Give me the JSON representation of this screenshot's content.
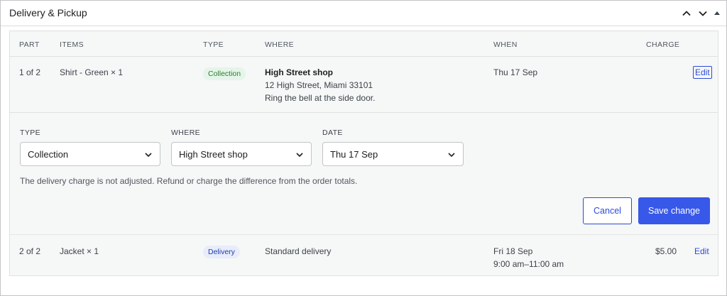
{
  "panel": {
    "title": "Delivery & Pickup",
    "controls": [
      "chevron-up-icon",
      "chevron-down-icon",
      "caret-up-icon"
    ]
  },
  "table": {
    "headers": [
      "Part",
      "Items",
      "Type",
      "Where",
      "When",
      "Charge"
    ],
    "rows": [
      {
        "part": "1 of 2",
        "items": "Shirt - Green × 1",
        "type": "Collection",
        "where_title": "High Street shop",
        "where_line1": "12 High Street, Miami 33101",
        "where_line2": "Ring the bell at the side door.",
        "when": "Thu 17 Sep",
        "charge": "",
        "action": "Edit"
      },
      {
        "part": "2 of 2",
        "items": "Jacket × 1",
        "type": "Delivery",
        "where_title": "Standard delivery",
        "when": "Fri 18 Sep",
        "when_line2": "9:00 am–11:00 am",
        "charge": "$5.00",
        "action": "Edit"
      }
    ]
  },
  "edit_form": {
    "type_label": "Type",
    "type_value": "Collection",
    "where_label": "Where",
    "where_value": "High Street shop",
    "date_label": "Date",
    "date_value": "Thu 17 Sep",
    "note": "The delivery charge is not adjusted. Refund or charge the difference from the order totals.",
    "cancel_label": "Cancel",
    "save_label": "Save change"
  },
  "colors": {
    "accent": "#3858e9",
    "collection_badge_bg": "#e5f5e9",
    "delivery_badge_bg": "#e8ecfb"
  }
}
